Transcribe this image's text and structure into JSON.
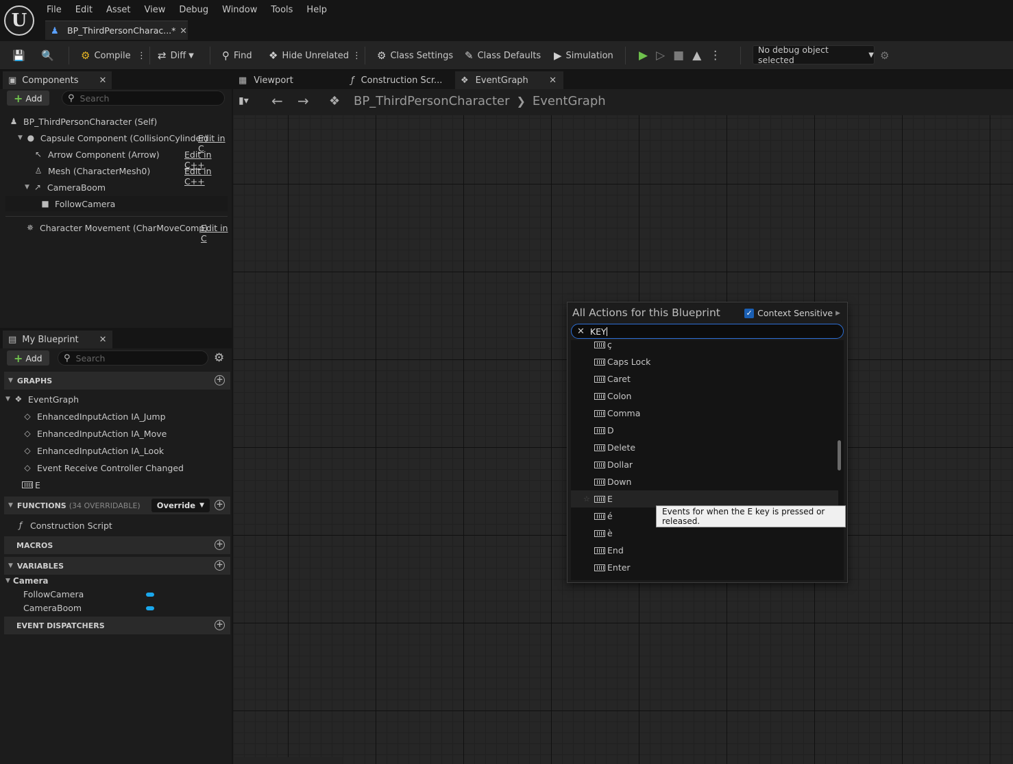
{
  "app": {
    "logo": "U",
    "menu": [
      "File",
      "Edit",
      "Asset",
      "View",
      "Debug",
      "Window",
      "Tools",
      "Help"
    ],
    "doc_tab": "BP_ThirdPersonCharac...*"
  },
  "toolbar": {
    "compile": "Compile",
    "diff": "Diff",
    "find": "Find",
    "hide_unrelated": "Hide Unrelated",
    "class_settings": "Class Settings",
    "class_defaults": "Class Defaults",
    "simulation": "Simulation",
    "debug_object": "No debug object selected"
  },
  "components": {
    "tab": "Components",
    "add": "Add",
    "search_placeholder": "Search",
    "items": [
      {
        "label": "BP_ThirdPersonCharacter (Self)"
      },
      {
        "label": "Capsule Component (CollisionCylinder)",
        "edit": "Edit in C"
      },
      {
        "label": "Arrow Component (Arrow)",
        "edit": "Edit in C++"
      },
      {
        "label": "Mesh (CharacterMesh0)",
        "edit": "Edit in C++"
      },
      {
        "label": "CameraBoom"
      },
      {
        "label": "FollowCamera"
      },
      {
        "label": "Character Movement (CharMoveComp)",
        "edit": "Edit in C"
      }
    ]
  },
  "my_blueprint": {
    "tab": "My Blueprint",
    "add": "Add",
    "search_placeholder": "Search",
    "graphs_header": "GRAPHS",
    "graphs": {
      "event_graph": "EventGraph",
      "events": [
        "EnhancedInputAction IA_Jump",
        "EnhancedInputAction IA_Move",
        "EnhancedInputAction IA_Look",
        "Event Receive Controller Changed",
        "E"
      ]
    },
    "functions_header": "FUNCTIONS",
    "functions_sub": "(34 OVERRIDABLE)",
    "override": "Override",
    "functions": [
      "Construction Script"
    ],
    "macros_header": "MACROS",
    "variables_header": "VARIABLES",
    "variable_category": "Camera",
    "variables": [
      "FollowCamera",
      "CameraBoom"
    ],
    "dispatchers_header": "EVENT DISPATCHERS"
  },
  "graph": {
    "tabs": [
      "Viewport",
      "Construction Scr...",
      "EventGraph"
    ],
    "breadcrumb": [
      "BP_ThirdPersonCharacter",
      "EventGraph"
    ]
  },
  "action_menu": {
    "title": "All Actions for this Blueprint",
    "context_sensitive": "Context Sensitive",
    "search_value": "KEY",
    "items": [
      "ç",
      "Caps Lock",
      "Caret",
      "Colon",
      "Comma",
      "D",
      "Delete",
      "Dollar",
      "Down",
      "E",
      "é",
      "è",
      "End",
      "Enter"
    ],
    "highlighted": "E",
    "tooltip": "Events for when the E key is pressed or released."
  },
  "colors": {
    "accent_blue": "#1a5fb4",
    "play_green": "#6fc14d",
    "variable_pill": "#1aa7ec"
  }
}
